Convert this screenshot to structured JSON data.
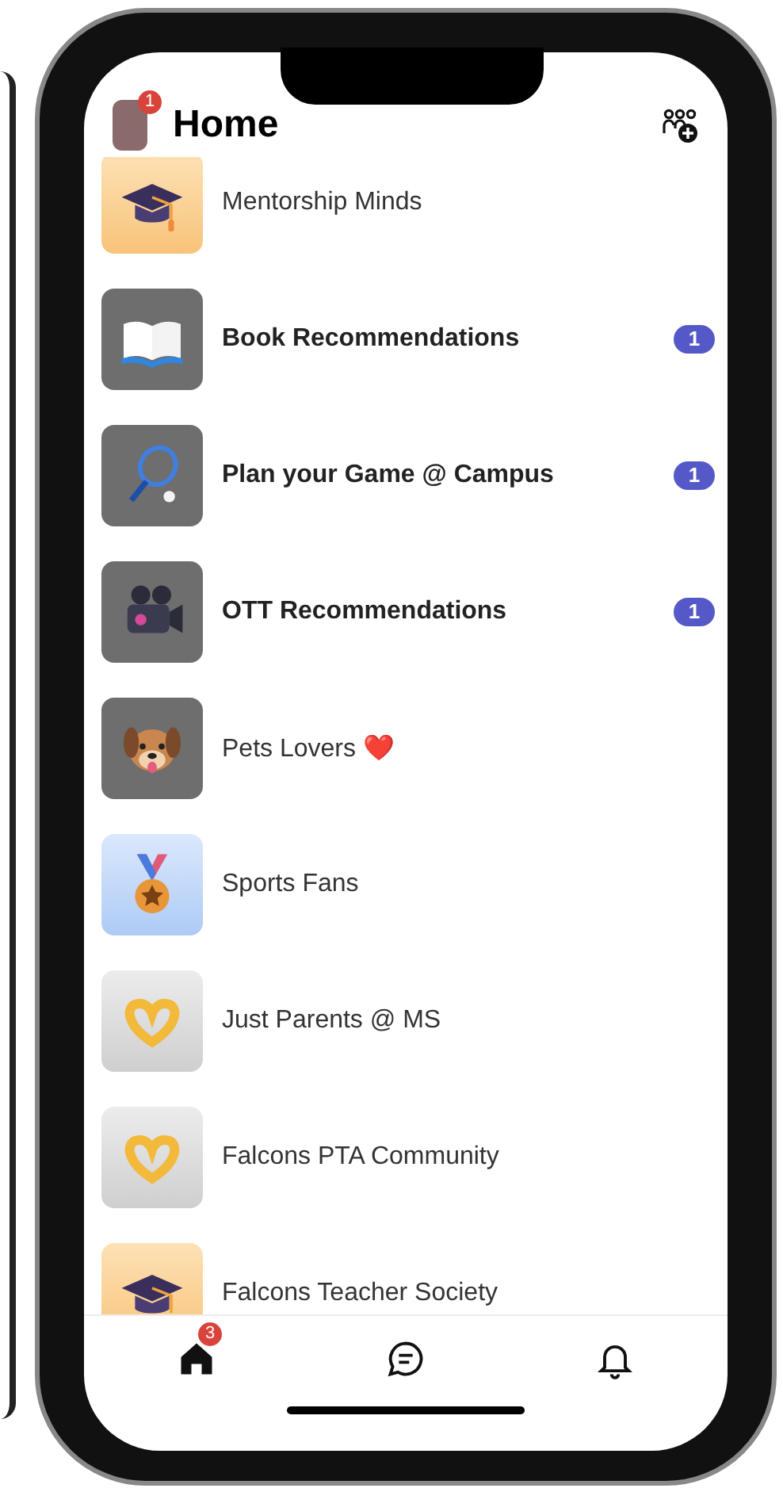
{
  "header": {
    "title": "Home",
    "avatar_badge": "1"
  },
  "groups": [
    {
      "name": "Mentorship Minds",
      "unread": false
    },
    {
      "name": "Book Recommendations",
      "unread": true,
      "count": "1"
    },
    {
      "name": "Plan your Game @ Campus",
      "unread": true,
      "count": "1"
    },
    {
      "name": "OTT Recommendations",
      "unread": true,
      "count": "1"
    },
    {
      "name": "Pets Lovers ❤️",
      "unread": false
    },
    {
      "name": "Sports Fans",
      "unread": false
    },
    {
      "name": "Just Parents @ MS",
      "unread": false
    },
    {
      "name": "Falcons PTA Community",
      "unread": false
    },
    {
      "name": "Falcons Teacher Society",
      "unread": false
    }
  ],
  "tab_bar": [
    {
      "kind": "home",
      "selected": true,
      "badge": "3"
    },
    {
      "kind": "chat",
      "selected": false
    },
    {
      "kind": "bell",
      "selected": false
    }
  ]
}
